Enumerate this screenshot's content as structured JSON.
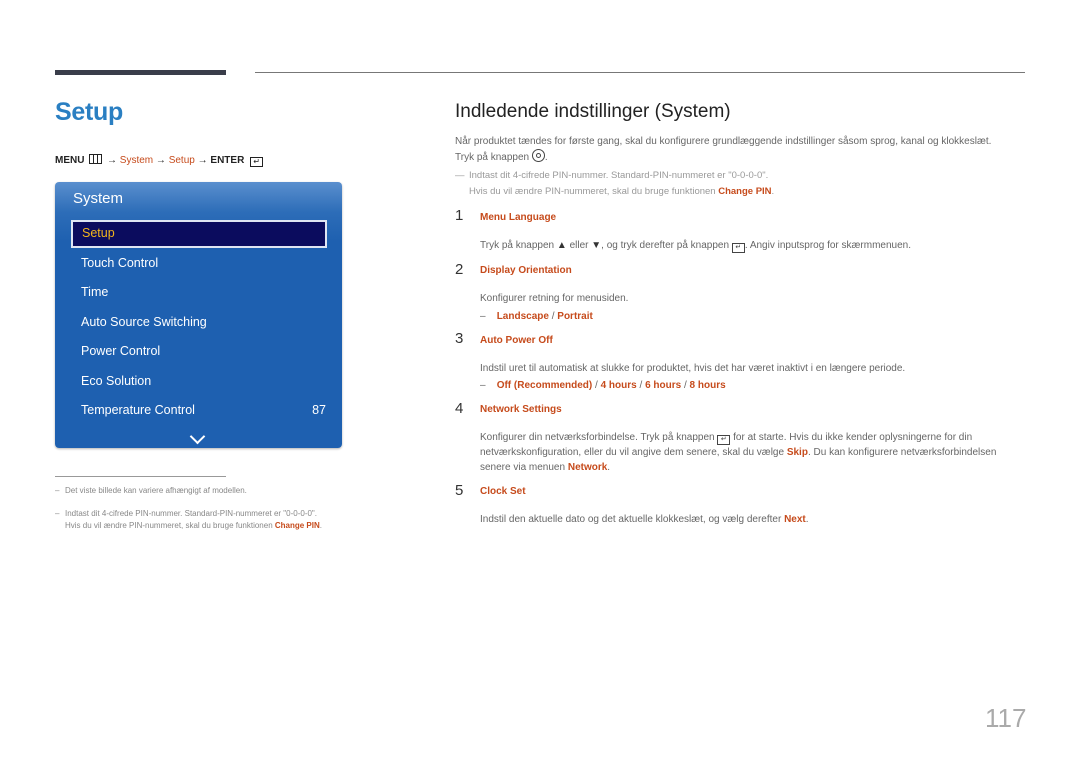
{
  "page": {
    "title": "Setup",
    "page_number": "117"
  },
  "menu_path": {
    "menu": "MENU",
    "arrow": "→",
    "system": "System",
    "setup": "Setup",
    "enter": "ENTER"
  },
  "osd": {
    "title": "System",
    "selected": "Setup",
    "items": [
      {
        "label": "Touch Control",
        "value": ""
      },
      {
        "label": "Time",
        "value": ""
      },
      {
        "label": "Auto Source Switching",
        "value": ""
      },
      {
        "label": "Power Control",
        "value": ""
      },
      {
        "label": "Eco Solution",
        "value": ""
      },
      {
        "label": "Temperature Control",
        "value": "87"
      }
    ]
  },
  "footnotes": [
    {
      "text": "Det viste billede kan variere afhængigt af modellen."
    },
    {
      "line1": "Indtast dit 4-cifrede PIN-nummer. Standard-PIN-nummeret er \"0-0-0-0\".",
      "line2": "Hvis du vil ændre PIN-nummeret, skal du bruge funktionen ",
      "link": "Change PIN",
      "end": "."
    }
  ],
  "section": {
    "title": "Indledende indstillinger (System)",
    "intro_line1": "Når produktet tændes for første gang, skal du konfigurere grundlæggende indstillinger såsom sprog, kanal og klokkeslæt.",
    "intro_line2": "Tryk på knappen",
    "note_line1": "Indtast dit 4-cifrede PIN-nummer. Standard-PIN-nummeret er \"0-0-0-0\".",
    "note_line2": "Hvis du vil ændre PIN-nummeret, skal du bruge funktionen ",
    "note_link": "Change PIN",
    "steps": [
      {
        "num": "1",
        "title": "Menu Language",
        "desc_a": "Tryk på knappen ",
        "desc_b": " eller ",
        "desc_c": ", og tryk derefter på knappen ",
        "desc_d": ". Angiv inputsprog for skærmmenuen."
      },
      {
        "num": "2",
        "title": "Display Orientation",
        "desc": "Konfigurer retning for menusiden.",
        "options": [
          "Landscape",
          "Portrait"
        ]
      },
      {
        "num": "3",
        "title": "Auto Power Off",
        "desc": "Indstil uret til automatisk at slukke for produktet, hvis det har været inaktivt i en længere periode.",
        "options": [
          "Off (Recommended)",
          "4 hours",
          "6 hours",
          "8 hours"
        ]
      },
      {
        "num": "4",
        "title": "Network Settings",
        "desc_a": "Konfigurer din netværksforbindelse. Tryk på knappen ",
        "desc_b": " for at starte. Hvis du ikke kender oplysningerne for din",
        "desc_c": "netværkskonfiguration, eller du vil angive dem senere, skal du vælge ",
        "skip": "Skip",
        "desc_d": ". Du kan konfigurere netværksforbindelsen",
        "desc_e": "senere via menuen ",
        "network": "Network",
        "desc_f": "."
      },
      {
        "num": "5",
        "title": "Clock Set",
        "desc_a": "Indstil den aktuelle dato og det aktuelle klokkeslæt, og vælg derefter ",
        "next": "Next",
        "desc_b": "."
      }
    ]
  }
}
